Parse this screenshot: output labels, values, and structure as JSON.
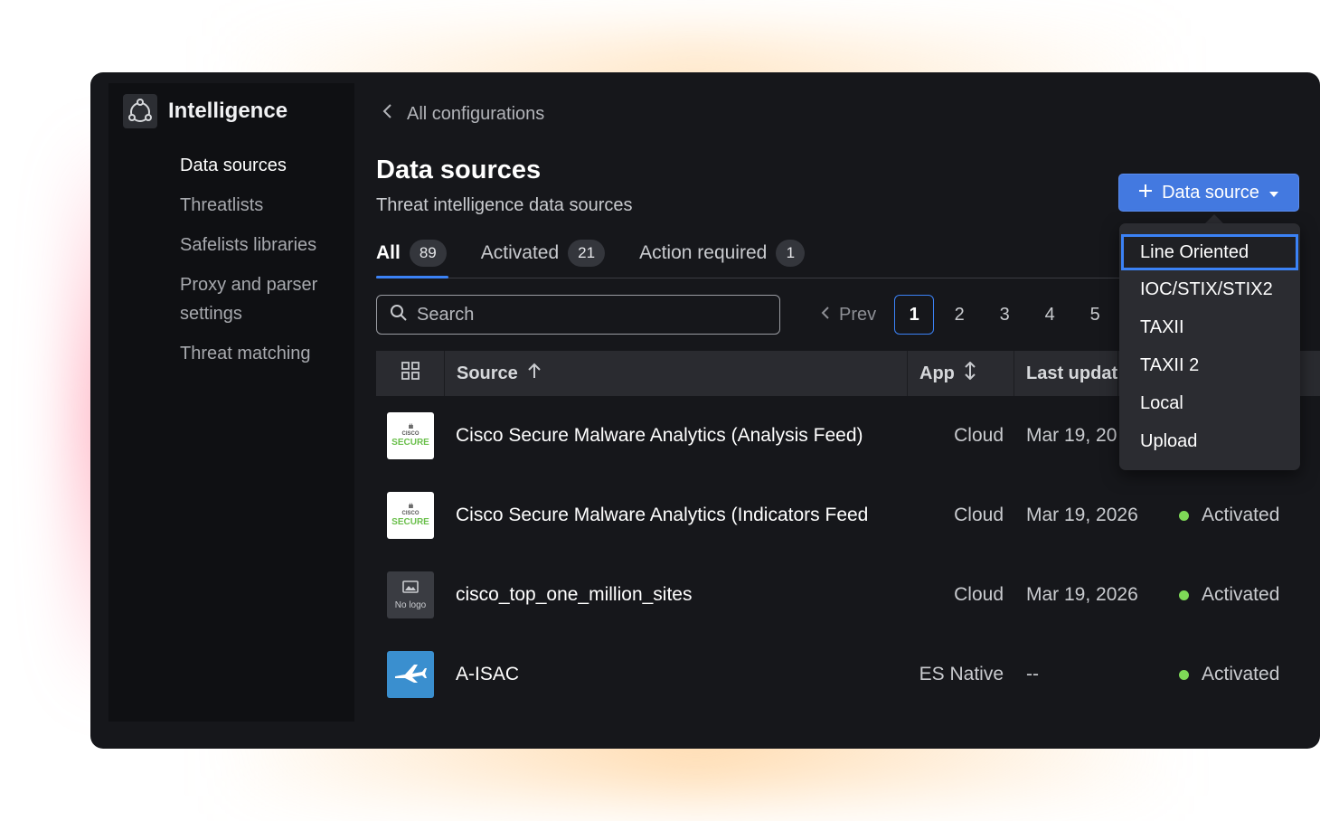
{
  "app": {
    "title": "Intelligence"
  },
  "sidebar": {
    "items": [
      {
        "label": "Data sources",
        "active": true
      },
      {
        "label": "Threatlists"
      },
      {
        "label": "Safelists libraries"
      },
      {
        "label": "Proxy and parser settings"
      },
      {
        "label": "Threat matching"
      }
    ]
  },
  "header": {
    "back_label": "All configurations",
    "title": "Data sources",
    "subtitle": "Threat intelligence data sources"
  },
  "tabs": [
    {
      "label": "All",
      "count": "89",
      "active": true
    },
    {
      "label": "Activated",
      "count": "21"
    },
    {
      "label": "Action required",
      "count": "1"
    }
  ],
  "search": {
    "placeholder": "Search",
    "value": ""
  },
  "pagination": {
    "prev_label": "Prev",
    "pages": [
      "1",
      "2",
      "3",
      "4",
      "5"
    ],
    "current": "1"
  },
  "table": {
    "columns": {
      "source": "Source",
      "app": "App",
      "last_updated": "Last updat"
    },
    "rows": [
      {
        "logo": "cisco-secure",
        "logo_text": "SECURE",
        "logo_sub": "CISCO",
        "source": "Cisco Secure Malware Analytics (Analysis Feed)",
        "app": "Cloud",
        "date": "Mar 19, 20",
        "status": ""
      },
      {
        "logo": "cisco-secure",
        "logo_text": "SECURE",
        "logo_sub": "CISCO",
        "source": "Cisco Secure Malware Analytics (Indicators Feed",
        "app": "Cloud",
        "date": "Mar 19, 2026",
        "status": "Activated"
      },
      {
        "logo": "no-logo",
        "logo_text": "No logo",
        "source": "cisco_top_one_million_sites",
        "app": "Cloud",
        "date": "Mar 19, 2026",
        "status": "Activated"
      },
      {
        "logo": "plane",
        "source": "A-ISAC",
        "app": "ES Native",
        "date": "--",
        "status": "Activated"
      }
    ]
  },
  "add_button": {
    "label": "Data source"
  },
  "menu": {
    "items": [
      "Line Oriented",
      "IOC/STIX/STIX2",
      "TAXII",
      "TAXII 2",
      "Local",
      "Upload"
    ],
    "focused": "Line Oriented"
  },
  "colors": {
    "accent": "#3b82f6",
    "button": "#4379e0",
    "status_active": "#7ed957",
    "background": "#16171b"
  }
}
